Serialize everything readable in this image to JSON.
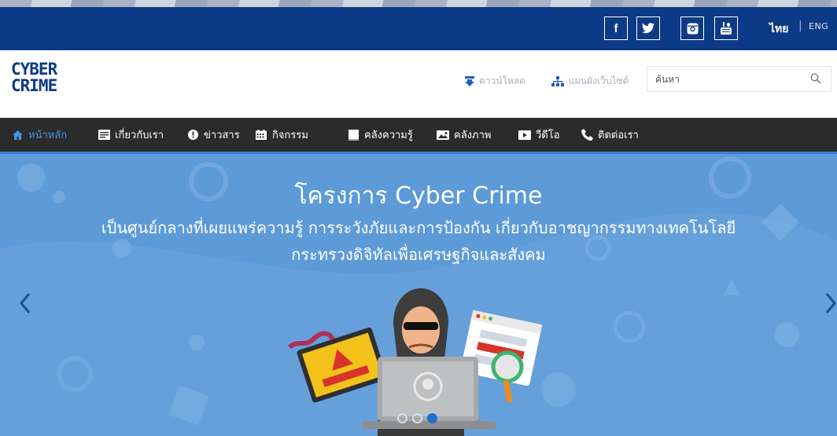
{
  "topbar": {
    "social": [
      {
        "name": "facebook",
        "glyph": "f"
      },
      {
        "name": "twitter",
        "glyph": "t"
      },
      {
        "name": "instagram",
        "glyph": "ig"
      },
      {
        "name": "youtube",
        "glyph": "yt"
      }
    ],
    "lang_thai": "ไทย",
    "lang_sep": "|",
    "lang_eng": "ENG"
  },
  "header": {
    "logo_line1": "CYBER",
    "logo_line2": "CRIME",
    "download_label": "ดาวน์โหลด",
    "sitemap_label": "แผนผังเว็บไซต์",
    "search_placeholder": "ค้นหา"
  },
  "nav": {
    "items": [
      {
        "label": "หน้าหลัก",
        "icon": "home-icon"
      },
      {
        "label": "เกี่ยวกับเรา",
        "icon": "document-icon"
      },
      {
        "label": "ข่าวสาร",
        "icon": "info-icon"
      },
      {
        "label": "กิจกรรม",
        "icon": "calendar-icon"
      },
      {
        "label": "คลังความรู้",
        "icon": "book-icon"
      },
      {
        "label": "คลังภาพ",
        "icon": "image-icon"
      },
      {
        "label": "วีดีโอ",
        "icon": "video-icon"
      },
      {
        "label": "ติดต่อเรา",
        "icon": "phone-icon"
      }
    ],
    "active_index": 0
  },
  "banner": {
    "title": "โครงการ Cyber Crime",
    "subtitle1": "เป็นศูนย์กลางที่เผยแพร่ความรู้ การระวังภัยและการป้องกัน เกี่ยวกับอาชญากรรมทางเทคโนโลยี",
    "subtitle2": "กระทรวงดิจิทัลเพื่อเศรษฐกิจและสังคม",
    "slides": 3,
    "active_slide": 2
  },
  "colors": {
    "topbar": "#0d3a86",
    "nav_bg": "#2b2b2b",
    "accent": "#3b7fd6",
    "banner_bg": "#5c9ad8"
  }
}
